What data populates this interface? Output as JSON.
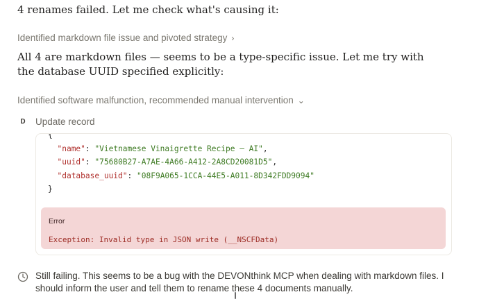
{
  "intro": "4 renames failed. Let me check what's causing it:",
  "step1": {
    "label": "Identified markdown file issue and pivoted strategy",
    "chevron": "›"
  },
  "paragraph": "All 4 are markdown files — seems to be a type-specific issue. Let me try with the database UUID specified explicitly:",
  "step2": {
    "label": "Identified software malfunction, recommended manual intervention",
    "chevron": "⌄"
  },
  "tool": {
    "badge": "D",
    "label": "Update record",
    "code": {
      "open": "{",
      "lines": [
        {
          "key": "\"name\"",
          "value": "\"Vietnamese Vinaigrette Recipe — AI\"",
          "sep": ","
        },
        {
          "key": "\"uuid\"",
          "value": "\"75680B27-A7AE-4A66-A412-2A8CD20081D5\"",
          "sep": ","
        },
        {
          "key": "\"database_uuid\"",
          "value": "\"08F9A065-1CCA-44E5-A011-8D342FDD9094\"",
          "sep": ""
        }
      ],
      "close": "}"
    },
    "error": {
      "title": "Error",
      "message": "Exception: Invalid type in JSON write (__NSCFData)"
    }
  },
  "thinking": {
    "icon": "clock-icon",
    "text": "Still failing. This seems to be a bug with the DEVONthink MCP when dealing with markdown files. I should inform the user and tell them to rename these 4 documents manually."
  },
  "colors": {
    "error_bg": "#f4d6d6",
    "key": "#b0312e",
    "string": "#3d7a22"
  }
}
